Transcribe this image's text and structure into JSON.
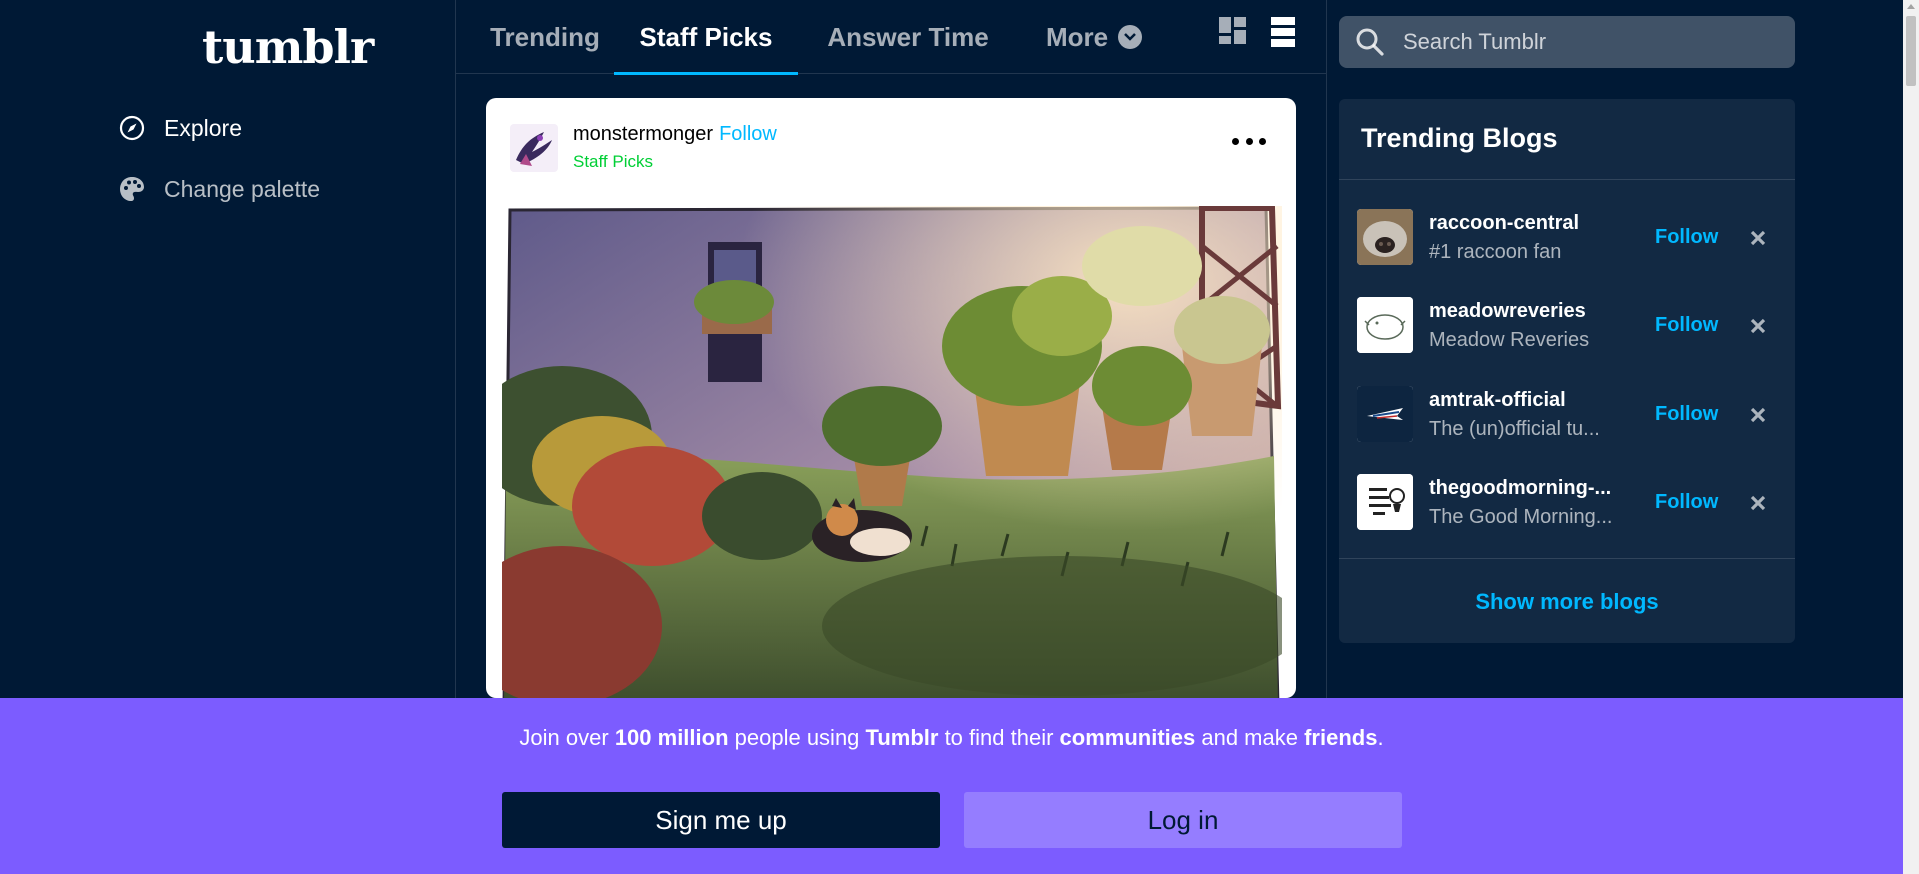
{
  "app": {
    "logo": "tumblr"
  },
  "sidebar": {
    "items": [
      {
        "label": "Explore",
        "icon": "compass-icon"
      },
      {
        "label": "Change palette",
        "icon": "palette-icon"
      }
    ]
  },
  "tabs": [
    {
      "label": "Trending",
      "active": false
    },
    {
      "label": "Staff Picks",
      "active": true
    },
    {
      "label": "Answer Time",
      "active": false
    },
    {
      "label": "More",
      "active": false,
      "icon": "chevron-down-icon"
    }
  ],
  "view_toggles": [
    "grid-view-icon",
    "list-view-icon"
  ],
  "post": {
    "username": "monstermonger",
    "follow_label": "Follow",
    "subtitle": "Staff Picks",
    "image_alt": "Painted garden with potted plants and a calico cat"
  },
  "search": {
    "placeholder": "Search Tumblr",
    "value": ""
  },
  "trending": {
    "title": "Trending Blogs",
    "blogs": [
      {
        "name": "raccoon-central",
        "description": "#1 raccoon fan",
        "follow": "Follow"
      },
      {
        "name": "meadowreveries",
        "description": "Meadow Reveries",
        "follow": "Follow"
      },
      {
        "name": "amtrak-official",
        "description": "The (un)official tu...",
        "follow": "Follow"
      },
      {
        "name": "thegoodmorning-...",
        "description": "The Good Morning...",
        "follow": "Follow"
      }
    ],
    "show_more": "Show more blogs"
  },
  "banner": {
    "text_parts": [
      "Join over ",
      "100 million",
      " people using ",
      "Tumblr",
      " to find their ",
      "communities",
      " and make ",
      "friends",
      "."
    ],
    "signup": "Sign me up",
    "login": "Log in"
  },
  "colors": {
    "background": "#001935",
    "accent": "#00b8ff",
    "green": "#00cf35",
    "banner": "#7c5cff",
    "login_button": "#957dff"
  }
}
